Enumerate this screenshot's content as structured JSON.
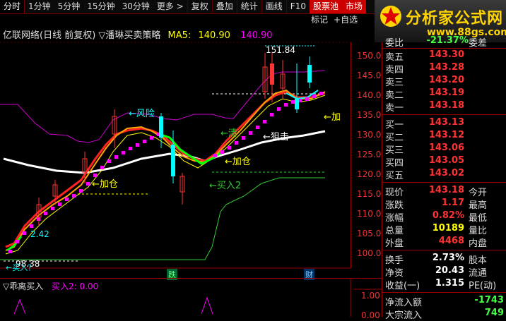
{
  "toolbar": {
    "items": [
      "分时",
      "1分钟",
      "5分钟",
      "15分钟",
      "30分钟",
      "更多 >",
      "复权",
      "叠加",
      "统计",
      "画线",
      "F10",
      "股票池",
      "市场"
    ],
    "row2": [
      "标记",
      "+自选"
    ]
  },
  "logo": {
    "title": "分析家公式网",
    "url": "www.88gs.com"
  },
  "chart": {
    "title": "亿联网络(日线 前复权) ▽潘琳买卖策略",
    "ma_label": "MA5:",
    "ma_value": "140.90",
    "ma_value2": "140.90"
  },
  "y_axis": [
    "150.0",
    "145.0",
    "140.0",
    "135.0",
    "130.0",
    "125.0",
    "120.0",
    "115.0",
    "110.0",
    "105.0",
    "100.0"
  ],
  "annotations": {
    "fengxian": "←风险",
    "jiacang1": "←加仓",
    "jiacang2": "←加仓",
    "jiacang3": "←加",
    "mairu": "←买入2",
    "jiji": "←狙击",
    "qing": "←清",
    "high": "151.84",
    "low": "98.38",
    "low_label": "←买入？",
    "die": "跌",
    "cai": "财",
    "left_val": "2.42"
  },
  "indicator": {
    "title": "▽乖离买入",
    "value_label": "买入2: 0.00",
    "scale_top": "1.00",
    "scale_bot": "0.00"
  },
  "quote": {
    "header_left": "委比",
    "header_val": "-21.37%",
    "header_right": "委差",
    "asks": [
      {
        "label": "卖五",
        "price": "143.30"
      },
      {
        "label": "卖四",
        "price": "143.28"
      },
      {
        "label": "卖三",
        "price": "143.20"
      },
      {
        "label": "卖二",
        "price": "143.19"
      },
      {
        "label": "卖一",
        "price": "143.18"
      }
    ],
    "bids": [
      {
        "label": "买一",
        "price": "143.13"
      },
      {
        "label": "买二",
        "price": "143.12"
      },
      {
        "label": "买三",
        "price": "143.06"
      },
      {
        "label": "买四",
        "price": "143.05"
      },
      {
        "label": "买五",
        "price": "143.02"
      }
    ],
    "stats": [
      {
        "k": "现价",
        "v": "143.18",
        "k2": "今开"
      },
      {
        "k": "涨跌",
        "v": "1.17",
        "k2": "最高"
      },
      {
        "k": "涨幅",
        "v": "0.82%",
        "k2": "最低"
      },
      {
        "k": "总量",
        "v": "10189",
        "k2": "量比"
      },
      {
        "k": "外盘",
        "v": "4468",
        "k2": "内盘"
      }
    ],
    "stats2": [
      {
        "k": "换手",
        "v": "2.73%",
        "k2": "股本"
      },
      {
        "k": "净资",
        "v": "20.43",
        "k2": "流通"
      },
      {
        "k": "收益(一)",
        "v": "1.315",
        "k2": "PE(动)"
      }
    ],
    "flow": {
      "k": "净流入额",
      "v": "-1743"
    },
    "flow2": {
      "k": "大宗流入",
      "v": "749"
    }
  }
}
